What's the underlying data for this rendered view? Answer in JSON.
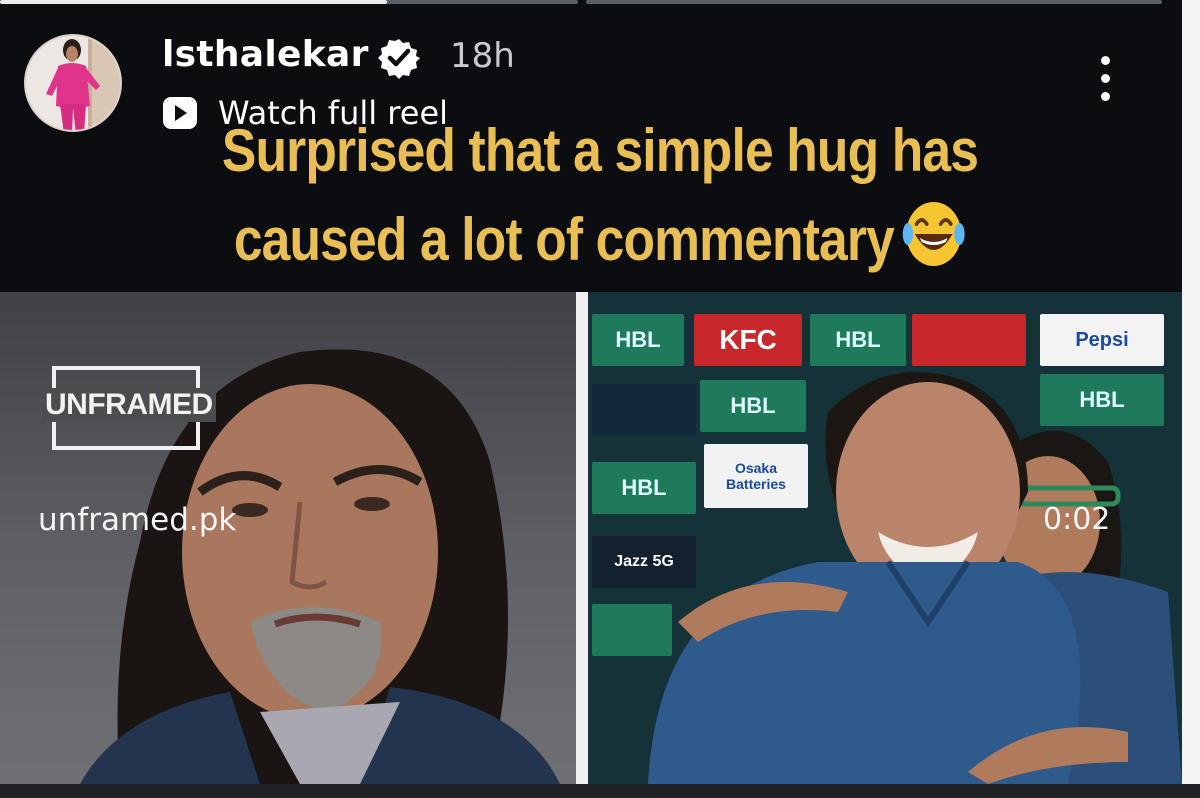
{
  "progress": {
    "segments": [
      {
        "played": 0.67
      },
      {
        "played": 0
      }
    ]
  },
  "post": {
    "username": "lsthalekar",
    "time_ago": "18h",
    "watch_label": "Watch full reel"
  },
  "caption": {
    "line1": "Surprised that a simple hug has",
    "line2": "caused a lot of commentary",
    "color": "#e9bf55"
  },
  "left_image": {
    "watermark_brand": "UNFRAMED",
    "watermark_handle": "unframed.pk"
  },
  "right_image": {
    "timestamp": "0:02",
    "sponsors": [
      "HBL",
      "KFC",
      "Pepsi",
      "Osaka Batteries",
      "Jazz 5G"
    ]
  },
  "icons": {
    "verified": "verified-badge-icon",
    "more": "more-vertical-icon",
    "reel": "play-reel-icon",
    "emoji": "laughing-tears-emoji"
  }
}
